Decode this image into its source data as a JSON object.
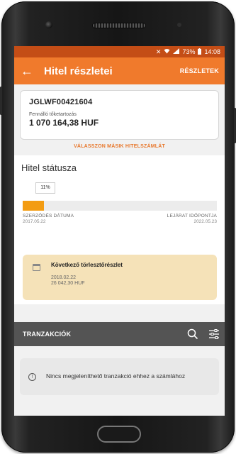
{
  "status_bar": {
    "battery": "73%",
    "time": "14:08"
  },
  "app_bar": {
    "title": "Hitel részletei",
    "action": "RÉSZLETEK"
  },
  "loan": {
    "id": "JGLWF00421604",
    "debt_label": "Fennálló tőketartozás",
    "debt_value": "1 070 164,38 HUF"
  },
  "other_account_link": "VÁLASSZON MÁSIK HITELSZÁMLÁT",
  "status": {
    "title": "Hitel státusza",
    "percent_label": "11%",
    "progress": 0.11,
    "contract_date_label": "SZERZŐDÉS DÁTUMA",
    "contract_date": "2017.05.22",
    "maturity_label": "LEJÁRAT IDŐPONTJA",
    "maturity_date": "2022.05.23"
  },
  "next_installment": {
    "title": "Következő törlesztőrészlet",
    "date": "2018.02.22",
    "amount": "26 042,30 HUF"
  },
  "transactions": {
    "label": "TRANZAKCIÓK",
    "empty_message": "Nincs megjeleníthető tranzakció ehhez a számlához"
  },
  "colors": {
    "primary": "#f07a2c",
    "status_bar": "#c44d16",
    "progress": "#f39c12",
    "info_card": "#f5e2b8",
    "section_bar": "#545454"
  }
}
